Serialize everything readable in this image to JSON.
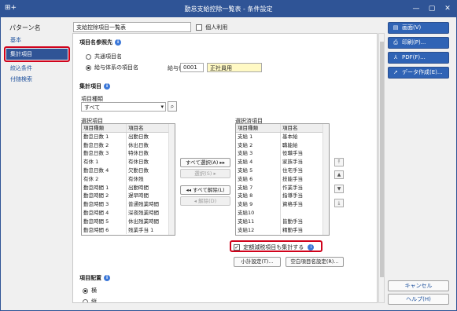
{
  "window": {
    "title": "勤怠支給控除一覧表 - 条件設定",
    "app_icon": "⊞+",
    "minimize": "—",
    "maximize": "▢",
    "close": "✕"
  },
  "header": {
    "pattern_label": "パターン名",
    "pattern_value": "支給控除項目一覧表",
    "personal_use_label": "個人利用"
  },
  "leftnav": {
    "items": [
      {
        "label": "基本"
      },
      {
        "label": "集計項目"
      },
      {
        "label": "絞込条件"
      },
      {
        "label": "付随検索"
      }
    ],
    "active_index": 1
  },
  "item_name_ref": {
    "title": "項目名参照先",
    "option1": "共通項目名",
    "option2": "給与体系の項目名",
    "field_label": "給与体系",
    "code": "0001",
    "name": "正社員用"
  },
  "aggregate": {
    "title": "集計項目",
    "item_type_label": "項目種類",
    "item_type_value": "すべて",
    "selection_label": "選択項目",
    "selected_label": "選択済項目",
    "col_type": "項目種類",
    "col_name": "項目名",
    "selection_rows": [
      [
        "勤怠日数 1",
        "出勤日数"
      ],
      [
        "勤怠日数 2",
        "休出日数"
      ],
      [
        "勤怠日数 3",
        "特休日数"
      ],
      [
        "有休 1",
        "有休日数"
      ],
      [
        "勤怠日数 4",
        "欠勤日数"
      ],
      [
        "有休 2",
        "有休残"
      ],
      [
        "勤怠時間 1",
        "出勤時間"
      ],
      [
        "勤怠時間 2",
        "遅早時間"
      ],
      [
        "勤怠時間 3",
        "普通残業時間"
      ],
      [
        "勤怠時間 4",
        "深夜残業時間"
      ],
      [
        "勤怠時間 5",
        "休出残業時間"
      ],
      [
        "勤怠時間 6",
        "残業手当 1"
      ]
    ],
    "selected_rows": [
      [
        "支給 1",
        "基本給"
      ],
      [
        "支給 2",
        "職能給"
      ],
      [
        "支給 3",
        "役職手当"
      ],
      [
        "支給 4",
        "家族手当"
      ],
      [
        "支給 5",
        "住宅手当"
      ],
      [
        "支給 6",
        "技能手当"
      ],
      [
        "支給 7",
        "作業手当"
      ],
      [
        "支給 8",
        "指導手当"
      ],
      [
        "支給 9",
        "資格手当"
      ],
      [
        "支給10",
        ""
      ],
      [
        "支給11",
        "皆勤手当"
      ],
      [
        "支給12",
        "精勤手当"
      ]
    ],
    "btn_select_all": "すべて選択(A)",
    "btn_select": "選択(S)",
    "btn_deselect_all": "すべて解除(L)",
    "btn_deselect": "解除(D)",
    "tax_include_label": "定額減税項目も集計する",
    "btn_subtotal": "小計設定(T)...",
    "btn_blank_item": "空白項目名設定(R)..."
  },
  "layout": {
    "title": "項目配置",
    "option_horizontal": "横",
    "option_vertical": "縦"
  },
  "rightpanel": {
    "screen": "画面(V)",
    "print": "印刷(P)...",
    "pdf": "PDF(F)...",
    "data": "データ作成(E)...",
    "cancel": "キャンセル",
    "help": "ヘルプ(H)"
  }
}
